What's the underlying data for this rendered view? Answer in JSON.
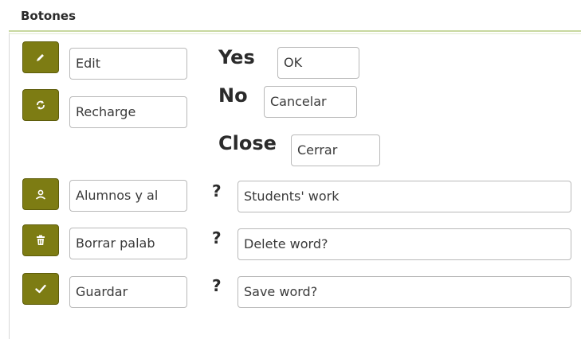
{
  "section": {
    "title": "Botones"
  },
  "buttons": [
    {
      "icon": "pencil-icon",
      "value": "Edit"
    },
    {
      "icon": "refresh-icon",
      "value": "Recharge"
    },
    {
      "icon": "user-icon",
      "value": "Alumnos y al"
    },
    {
      "icon": "trash-icon",
      "value": "Borrar palab"
    },
    {
      "icon": "check-icon",
      "value": "Guardar"
    }
  ],
  "dialog": {
    "yes_label": "Yes",
    "yes_value": "OK",
    "no_label": "No",
    "no_value": "Cancelar",
    "close_label": "Close",
    "close_value": "Cerrar"
  },
  "questions": [
    {
      "mark": "?",
      "value": "Students' work"
    },
    {
      "mark": "?",
      "value": "Delete word?"
    },
    {
      "mark": "?",
      "value": "Save word?"
    }
  ],
  "colors": {
    "button": "#7d7c13",
    "accent_line": "#c8d8a0"
  }
}
